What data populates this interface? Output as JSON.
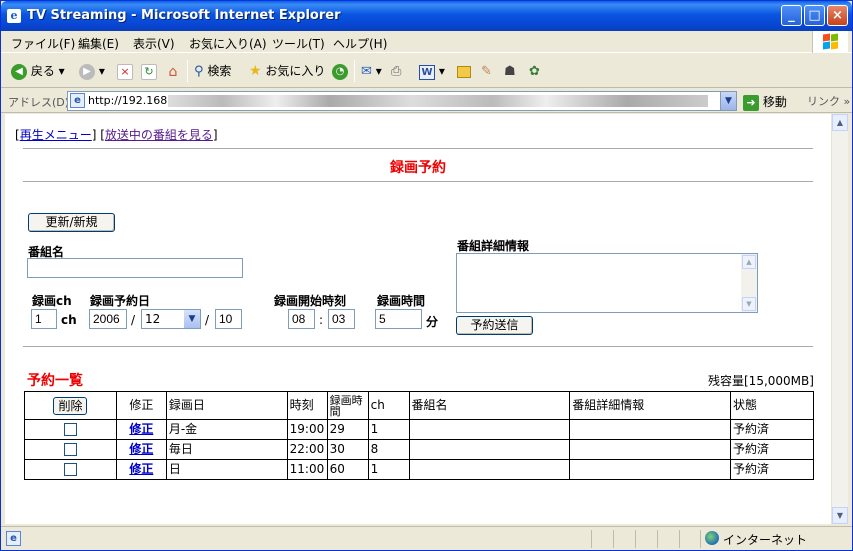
{
  "window": {
    "title": "TV Streaming - Microsoft Internet Explorer"
  },
  "menu": [
    "ファイル(F)",
    "編集(E)",
    "表示(V)",
    "お気に入り(A)",
    "ツール(T)",
    "ヘルプ(H)"
  ],
  "toolbar": {
    "back": "戻る",
    "search": "検索",
    "favorites": "お気に入り"
  },
  "address": {
    "label": "アドレス(D)",
    "url": "http://192.168.",
    "go": "移動",
    "links": "リンク"
  },
  "nav": {
    "replay_menu": "再生メニュー",
    "live_programs": "放送中の番組を見る"
  },
  "page": {
    "title": "録画予約",
    "refresh_button": "更新/新規",
    "program_name_label": "番組名",
    "program_name_value": "",
    "detail_label": "番組詳細情報",
    "channel_label": "録画ch",
    "channel_value": "1",
    "channel_unit": "ch",
    "date_label": "録画予約日",
    "year_value": "2006",
    "month_value": "12",
    "day_value": "10",
    "start_label": "録画開始時刻",
    "start_hour": "08",
    "start_min": "03",
    "duration_label": "録画時間",
    "duration_value": "5",
    "duration_unit": "分",
    "submit_button": "予約送信",
    "list_title": "予約一覧",
    "capacity": "残容量[15,000MB]"
  },
  "table": {
    "headers": {
      "delete": "削除",
      "edit": "修正",
      "date": "録画日",
      "time": "時刻",
      "duration": "録画時間",
      "ch": "ch",
      "name": "番組名",
      "detail": "番組詳細情報",
      "status": "状態"
    },
    "rows": [
      {
        "edit": "修正",
        "date": "月-金",
        "time": "19:00",
        "duration": "29",
        "ch": "1",
        "name": "",
        "detail": "",
        "status": "予約済"
      },
      {
        "edit": "修正",
        "date": "毎日",
        "time": "22:00",
        "duration": "30",
        "ch": "8",
        "name": "",
        "detail": "",
        "status": "予約済"
      },
      {
        "edit": "修正",
        "date": "日",
        "time": "11:00",
        "duration": "60",
        "ch": "1",
        "name": "",
        "detail": "",
        "status": "予約済"
      }
    ]
  },
  "status": {
    "zone": "インターネット"
  }
}
